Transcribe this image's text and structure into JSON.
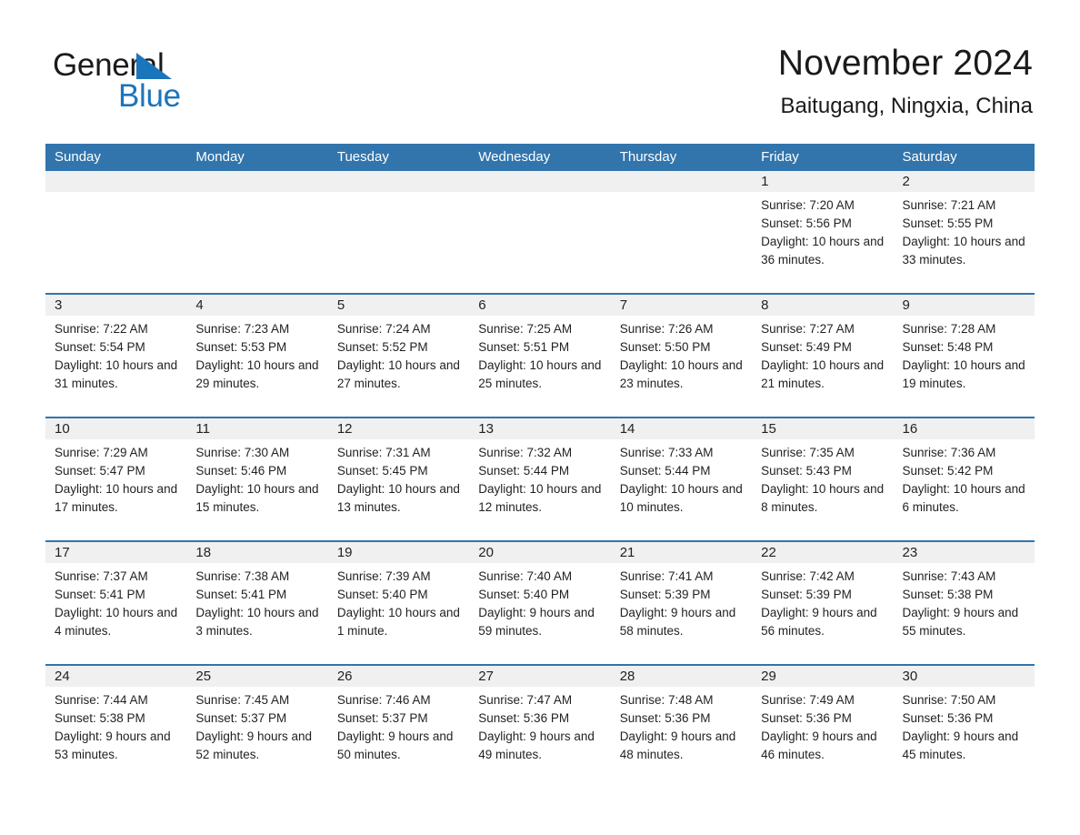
{
  "brand": {
    "name_part1": "General",
    "name_part2": "Blue",
    "triangle_icon": "triangle-icon",
    "accent_color": "#1b75bb"
  },
  "header": {
    "title": "November 2024",
    "subtitle": "Baitugang, Ningxia, China"
  },
  "colors": {
    "header_blue": "#3275ad",
    "date_band_gray": "#f0f0f0",
    "text": "#231f20"
  },
  "weekdays": [
    "Sunday",
    "Monday",
    "Tuesday",
    "Wednesday",
    "Thursday",
    "Friday",
    "Saturday"
  ],
  "weeks": [
    [
      {
        "day": "",
        "sunrise": "",
        "sunset": "",
        "daylight": ""
      },
      {
        "day": "",
        "sunrise": "",
        "sunset": "",
        "daylight": ""
      },
      {
        "day": "",
        "sunrise": "",
        "sunset": "",
        "daylight": ""
      },
      {
        "day": "",
        "sunrise": "",
        "sunset": "",
        "daylight": ""
      },
      {
        "day": "",
        "sunrise": "",
        "sunset": "",
        "daylight": ""
      },
      {
        "day": "1",
        "sunrise": "Sunrise: 7:20 AM",
        "sunset": "Sunset: 5:56 PM",
        "daylight": "Daylight: 10 hours and 36 minutes."
      },
      {
        "day": "2",
        "sunrise": "Sunrise: 7:21 AM",
        "sunset": "Sunset: 5:55 PM",
        "daylight": "Daylight: 10 hours and 33 minutes."
      }
    ],
    [
      {
        "day": "3",
        "sunrise": "Sunrise: 7:22 AM",
        "sunset": "Sunset: 5:54 PM",
        "daylight": "Daylight: 10 hours and 31 minutes."
      },
      {
        "day": "4",
        "sunrise": "Sunrise: 7:23 AM",
        "sunset": "Sunset: 5:53 PM",
        "daylight": "Daylight: 10 hours and 29 minutes."
      },
      {
        "day": "5",
        "sunrise": "Sunrise: 7:24 AM",
        "sunset": "Sunset: 5:52 PM",
        "daylight": "Daylight: 10 hours and 27 minutes."
      },
      {
        "day": "6",
        "sunrise": "Sunrise: 7:25 AM",
        "sunset": "Sunset: 5:51 PM",
        "daylight": "Daylight: 10 hours and 25 minutes."
      },
      {
        "day": "7",
        "sunrise": "Sunrise: 7:26 AM",
        "sunset": "Sunset: 5:50 PM",
        "daylight": "Daylight: 10 hours and 23 minutes."
      },
      {
        "day": "8",
        "sunrise": "Sunrise: 7:27 AM",
        "sunset": "Sunset: 5:49 PM",
        "daylight": "Daylight: 10 hours and 21 minutes."
      },
      {
        "day": "9",
        "sunrise": "Sunrise: 7:28 AM",
        "sunset": "Sunset: 5:48 PM",
        "daylight": "Daylight: 10 hours and 19 minutes."
      }
    ],
    [
      {
        "day": "10",
        "sunrise": "Sunrise: 7:29 AM",
        "sunset": "Sunset: 5:47 PM",
        "daylight": "Daylight: 10 hours and 17 minutes."
      },
      {
        "day": "11",
        "sunrise": "Sunrise: 7:30 AM",
        "sunset": "Sunset: 5:46 PM",
        "daylight": "Daylight: 10 hours and 15 minutes."
      },
      {
        "day": "12",
        "sunrise": "Sunrise: 7:31 AM",
        "sunset": "Sunset: 5:45 PM",
        "daylight": "Daylight: 10 hours and 13 minutes."
      },
      {
        "day": "13",
        "sunrise": "Sunrise: 7:32 AM",
        "sunset": "Sunset: 5:44 PM",
        "daylight": "Daylight: 10 hours and 12 minutes."
      },
      {
        "day": "14",
        "sunrise": "Sunrise: 7:33 AM",
        "sunset": "Sunset: 5:44 PM",
        "daylight": "Daylight: 10 hours and 10 minutes."
      },
      {
        "day": "15",
        "sunrise": "Sunrise: 7:35 AM",
        "sunset": "Sunset: 5:43 PM",
        "daylight": "Daylight: 10 hours and 8 minutes."
      },
      {
        "day": "16",
        "sunrise": "Sunrise: 7:36 AM",
        "sunset": "Sunset: 5:42 PM",
        "daylight": "Daylight: 10 hours and 6 minutes."
      }
    ],
    [
      {
        "day": "17",
        "sunrise": "Sunrise: 7:37 AM",
        "sunset": "Sunset: 5:41 PM",
        "daylight": "Daylight: 10 hours and 4 minutes."
      },
      {
        "day": "18",
        "sunrise": "Sunrise: 7:38 AM",
        "sunset": "Sunset: 5:41 PM",
        "daylight": "Daylight: 10 hours and 3 minutes."
      },
      {
        "day": "19",
        "sunrise": "Sunrise: 7:39 AM",
        "sunset": "Sunset: 5:40 PM",
        "daylight": "Daylight: 10 hours and 1 minute."
      },
      {
        "day": "20",
        "sunrise": "Sunrise: 7:40 AM",
        "sunset": "Sunset: 5:40 PM",
        "daylight": "Daylight: 9 hours and 59 minutes."
      },
      {
        "day": "21",
        "sunrise": "Sunrise: 7:41 AM",
        "sunset": "Sunset: 5:39 PM",
        "daylight": "Daylight: 9 hours and 58 minutes."
      },
      {
        "day": "22",
        "sunrise": "Sunrise: 7:42 AM",
        "sunset": "Sunset: 5:39 PM",
        "daylight": "Daylight: 9 hours and 56 minutes."
      },
      {
        "day": "23",
        "sunrise": "Sunrise: 7:43 AM",
        "sunset": "Sunset: 5:38 PM",
        "daylight": "Daylight: 9 hours and 55 minutes."
      }
    ],
    [
      {
        "day": "24",
        "sunrise": "Sunrise: 7:44 AM",
        "sunset": "Sunset: 5:38 PM",
        "daylight": "Daylight: 9 hours and 53 minutes."
      },
      {
        "day": "25",
        "sunrise": "Sunrise: 7:45 AM",
        "sunset": "Sunset: 5:37 PM",
        "daylight": "Daylight: 9 hours and 52 minutes."
      },
      {
        "day": "26",
        "sunrise": "Sunrise: 7:46 AM",
        "sunset": "Sunset: 5:37 PM",
        "daylight": "Daylight: 9 hours and 50 minutes."
      },
      {
        "day": "27",
        "sunrise": "Sunrise: 7:47 AM",
        "sunset": "Sunset: 5:36 PM",
        "daylight": "Daylight: 9 hours and 49 minutes."
      },
      {
        "day": "28",
        "sunrise": "Sunrise: 7:48 AM",
        "sunset": "Sunset: 5:36 PM",
        "daylight": "Daylight: 9 hours and 48 minutes."
      },
      {
        "day": "29",
        "sunrise": "Sunrise: 7:49 AM",
        "sunset": "Sunset: 5:36 PM",
        "daylight": "Daylight: 9 hours and 46 minutes."
      },
      {
        "day": "30",
        "sunrise": "Sunrise: 7:50 AM",
        "sunset": "Sunset: 5:36 PM",
        "daylight": "Daylight: 9 hours and 45 minutes."
      }
    ]
  ]
}
